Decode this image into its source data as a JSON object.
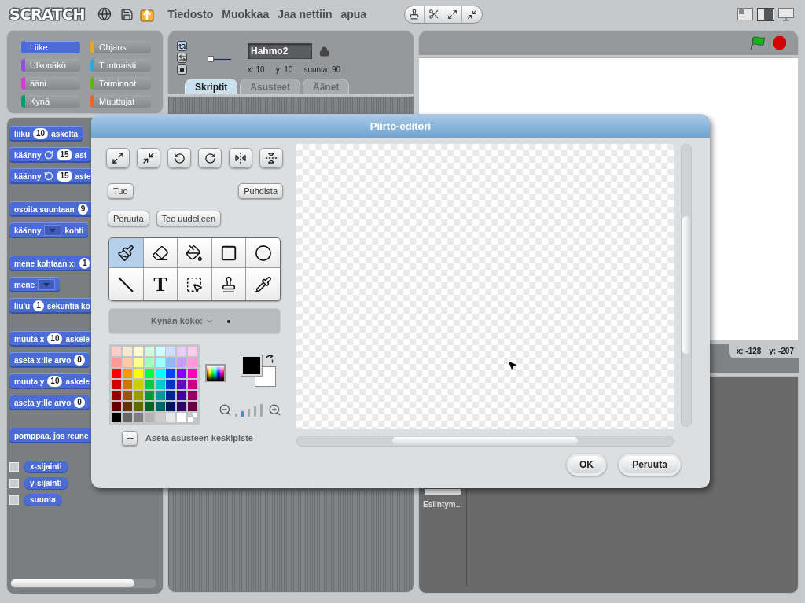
{
  "menu_bar": {
    "logo": "SCRATCH",
    "menus": [
      "Tiedosto",
      "Muokkaa",
      "Jaa nettiin",
      "apua"
    ]
  },
  "categories": [
    {
      "label": "Liike",
      "color": "#4a6cd4",
      "selected": true
    },
    {
      "label": "Ohjaus",
      "color": "#e6a822",
      "selected": false
    },
    {
      "label": "Ulkonäkö",
      "color": "#8a55d7",
      "selected": false
    },
    {
      "label": "Tuntoaisti",
      "color": "#2ca5e2",
      "selected": false
    },
    {
      "label": "ääni",
      "color": "#cf3fd0",
      "selected": false
    },
    {
      "label": "Toiminnot",
      "color": "#5cb712",
      "selected": false
    },
    {
      "label": "Kynä",
      "color": "#0e9a6c",
      "selected": false
    },
    {
      "label": "Muuttujat",
      "color": "#ee6521",
      "selected": false
    }
  ],
  "block_groups": [
    [
      {
        "parts": [
          {
            "kind": "text",
            "text": "liiku"
          },
          {
            "kind": "number",
            "text": "10"
          },
          {
            "kind": "text",
            "text": "askelta"
          }
        ]
      },
      {
        "parts": [
          {
            "kind": "text",
            "text": "käänny"
          },
          {
            "kind": "cw"
          },
          {
            "kind": "number",
            "text": "15"
          },
          {
            "kind": "text",
            "text": "ast"
          }
        ]
      },
      {
        "parts": [
          {
            "kind": "text",
            "text": "käänny"
          },
          {
            "kind": "ccw"
          },
          {
            "kind": "number",
            "text": "15"
          },
          {
            "kind": "text",
            "text": "aste"
          }
        ]
      }
    ],
    [
      {
        "parts": [
          {
            "kind": "text",
            "text": "osoita suuntaan"
          },
          {
            "kind": "number",
            "text": "9"
          }
        ]
      },
      {
        "parts": [
          {
            "kind": "text",
            "text": "käänny"
          },
          {
            "kind": "menu"
          },
          {
            "kind": "text",
            "text": "kohti"
          }
        ]
      }
    ],
    [
      {
        "parts": [
          {
            "kind": "text",
            "text": "mene kohtaan x:"
          },
          {
            "kind": "number",
            "text": "1"
          }
        ]
      },
      {
        "parts": [
          {
            "kind": "text",
            "text": "mene"
          },
          {
            "kind": "menu"
          }
        ]
      },
      {
        "parts": [
          {
            "kind": "text",
            "text": "liu'u"
          },
          {
            "kind": "number",
            "text": "1"
          },
          {
            "kind": "text",
            "text": "sekuntia ko"
          }
        ]
      }
    ],
    [
      {
        "parts": [
          {
            "kind": "text",
            "text": "muuta x"
          },
          {
            "kind": "number",
            "text": "10"
          },
          {
            "kind": "text",
            "text": "askele"
          }
        ]
      },
      {
        "parts": [
          {
            "kind": "text",
            "text": "aseta x:lle arvo"
          },
          {
            "kind": "number",
            "text": "0"
          }
        ]
      },
      {
        "parts": [
          {
            "kind": "text",
            "text": "muuta y"
          },
          {
            "kind": "number",
            "text": "10"
          },
          {
            "kind": "text",
            "text": "askele"
          }
        ]
      },
      {
        "parts": [
          {
            "kind": "text",
            "text": "aseta y:lle arvo"
          },
          {
            "kind": "number",
            "text": "0"
          }
        ]
      }
    ],
    [
      {
        "parts": [
          {
            "kind": "text",
            "text": "pomppaa, jos reune"
          }
        ]
      }
    ]
  ],
  "reporters": [
    {
      "label": "x-sijainti",
      "checked": false
    },
    {
      "label": "y-sijainti",
      "checked": false
    },
    {
      "label": "suunta",
      "checked": false
    }
  ],
  "sprite": {
    "name": "Hahmo2",
    "x": "x: 10",
    "y": "y: 10",
    "direction": "suunta: 90",
    "rotation_styles": [
      {
        "kind": "rotate",
        "selected": true
      },
      {
        "kind": "flip",
        "selected": false
      },
      {
        "kind": "none",
        "selected": false
      }
    ]
  },
  "tabs": [
    {
      "label": "Skriptit",
      "selected": true
    },
    {
      "label": "Asusteet",
      "selected": false
    },
    {
      "label": "Äänet",
      "selected": false
    }
  ],
  "stage": {
    "mouse_x": "x: -128",
    "mouse_y": "y: -207"
  },
  "sprite_list": {
    "stage_label": "Esiintym..."
  },
  "paint_editor": {
    "title": "Piirto-editori",
    "import": "Tuo",
    "clear": "Puhdista",
    "undo": "Peruuta",
    "redo": "Tee uudelleen",
    "tools": [
      {
        "kind": "brush",
        "selected": true
      },
      {
        "kind": "eraser",
        "selected": false
      },
      {
        "kind": "fill",
        "selected": false
      },
      {
        "kind": "rect",
        "selected": false
      },
      {
        "kind": "ellipse",
        "selected": false
      },
      {
        "kind": "line",
        "selected": false
      },
      {
        "kind": "text",
        "glyph": "T",
        "selected": false
      },
      {
        "kind": "select",
        "selected": false
      },
      {
        "kind": "stamp",
        "selected": false
      },
      {
        "kind": "eyedropper",
        "selected": false
      }
    ],
    "option_label": "Kynän koko:",
    "palette": [
      {
        "kind": "color",
        "color": "#ffcccc"
      },
      {
        "kind": "color",
        "color": "#ffe6cc"
      },
      {
        "kind": "color",
        "color": "#ffffcc"
      },
      {
        "kind": "color",
        "color": "#ccffdd"
      },
      {
        "kind": "color",
        "color": "#ccffff"
      },
      {
        "kind": "color",
        "color": "#ccddff"
      },
      {
        "kind": "color",
        "color": "#e6ccff"
      },
      {
        "kind": "color",
        "color": "#ffccee"
      },
      {
        "kind": "color",
        "color": "#ff9999"
      },
      {
        "kind": "color",
        "color": "#ffcc99"
      },
      {
        "kind": "color",
        "color": "#ffff99"
      },
      {
        "kind": "color",
        "color": "#99ffbb"
      },
      {
        "kind": "color",
        "color": "#99ffff"
      },
      {
        "kind": "color",
        "color": "#99b3ff"
      },
      {
        "kind": "color",
        "color": "#cc99ff"
      },
      {
        "kind": "color",
        "color": "#ff99dd"
      },
      {
        "kind": "color",
        "color": "#ff0000"
      },
      {
        "kind": "color",
        "color": "#ff9900"
      },
      {
        "kind": "color",
        "color": "#ffff00"
      },
      {
        "kind": "color",
        "color": "#00ff44"
      },
      {
        "kind": "color",
        "color": "#00ffff"
      },
      {
        "kind": "color",
        "color": "#0044ff"
      },
      {
        "kind": "color",
        "color": "#8800ff"
      },
      {
        "kind": "color",
        "color": "#ff00bb"
      },
      {
        "kind": "color",
        "color": "#cc0000"
      },
      {
        "kind": "color",
        "color": "#cc7700"
      },
      {
        "kind": "color",
        "color": "#cccc00"
      },
      {
        "kind": "color",
        "color": "#00cc44"
      },
      {
        "kind": "color",
        "color": "#00cccc"
      },
      {
        "kind": "color",
        "color": "#0033cc"
      },
      {
        "kind": "color",
        "color": "#6600cc"
      },
      {
        "kind": "color",
        "color": "#cc0088"
      },
      {
        "kind": "color",
        "color": "#990000"
      },
      {
        "kind": "color",
        "color": "#995500"
      },
      {
        "kind": "color",
        "color": "#999900"
      },
      {
        "kind": "color",
        "color": "#009933"
      },
      {
        "kind": "color",
        "color": "#009999"
      },
      {
        "kind": "color",
        "color": "#002299"
      },
      {
        "kind": "color",
        "color": "#440099"
      },
      {
        "kind": "color",
        "color": "#990066"
      },
      {
        "kind": "color",
        "color": "#660000"
      },
      {
        "kind": "color",
        "color": "#663300"
      },
      {
        "kind": "color",
        "color": "#666600"
      },
      {
        "kind": "color",
        "color": "#006622"
      },
      {
        "kind": "color",
        "color": "#006666"
      },
      {
        "kind": "color",
        "color": "#001166"
      },
      {
        "kind": "color",
        "color": "#330066"
      },
      {
        "kind": "color",
        "color": "#660044"
      },
      {
        "kind": "color",
        "color": "#000000"
      },
      {
        "kind": "color",
        "color": "#666666"
      },
      {
        "kind": "color",
        "color": "#808080"
      },
      {
        "kind": "color",
        "color": "#b3b3b3"
      },
      {
        "kind": "color",
        "color": "#cccccc"
      },
      {
        "kind": "color",
        "color": "#e6e6e6"
      },
      {
        "kind": "color",
        "color": "#ffffff"
      },
      {
        "kind": "transparent"
      }
    ],
    "pen_colors": [
      {
        "kind": "foreground",
        "color": "#000000"
      },
      {
        "kind": "background",
        "color": "#ffffff"
      }
    ],
    "zoom_levels": [
      {
        "selected": false
      },
      {
        "selected": true
      },
      {
        "selected": false
      },
      {
        "selected": false
      },
      {
        "selected": false
      }
    ],
    "set_center": "Aseta asusteen keskipiste",
    "actions": [
      "OK",
      "Peruuta"
    ]
  }
}
